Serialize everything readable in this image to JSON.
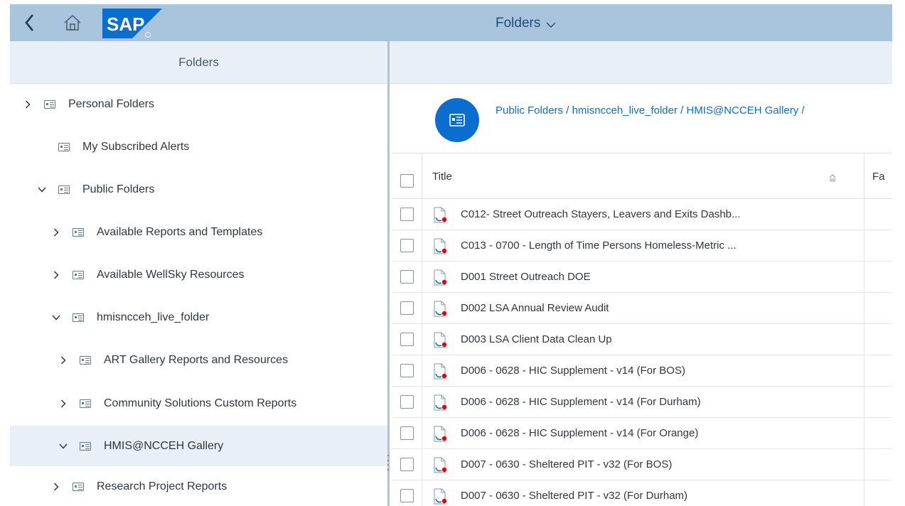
{
  "header": {
    "title": "Folders",
    "logo_text": "SAP",
    "colors": {
      "bar": "#a9c5de",
      "title": "#1f4e79",
      "logo": "#0a6ed1"
    }
  },
  "left_panel": {
    "title": "Folders",
    "items": [
      {
        "label": "Personal Folders",
        "expander": "collapsed"
      },
      {
        "label": "My Subscribed Alerts",
        "expander": "none"
      },
      {
        "label": "Public Folders",
        "expander": "expanded"
      },
      {
        "label": "Available Reports and Templates",
        "expander": "collapsed"
      },
      {
        "label": "Available WellSky Resources",
        "expander": "collapsed"
      },
      {
        "label": "hmisncceh_live_folder",
        "expander": "expanded"
      },
      {
        "label": "ART Gallery Reports and Resources",
        "expander": "collapsed"
      },
      {
        "label": "Community Solutions Custom Reports",
        "expander": "collapsed"
      },
      {
        "label": "HMIS@NCCEH Gallery",
        "expander": "expanded",
        "selected": true
      },
      {
        "label": "Research Project Reports",
        "expander": "collapsed"
      }
    ]
  },
  "breadcrumb": {
    "items": [
      "Public Folders",
      "hmisncceh_live_folder",
      "HMIS@NCCEH Gallery"
    ],
    "separator": "/"
  },
  "table": {
    "columns": {
      "title": "Title",
      "favorite": "Fa"
    },
    "rows": [
      "C012- Street Outreach Stayers, Leavers and Exits Dashb...",
      "C013 - 0700 - Length of Time Persons Homeless-Metric ...",
      "D001 Street Outreach DOE",
      "D002 LSA Annual Review Audit",
      "D003 LSA Client Data Clean Up",
      "D006 - 0628 - HIC Supplement - v14 (For BOS)",
      "D006 - 0628 - HIC Supplement - v14 (For Durham)",
      "D006 - 0628 - HIC Supplement - v14 (For Orange)",
      "D007 - 0630 - Sheltered PIT - v32 (For BOS)",
      "D007 - 0630 - Sheltered PIT - v32 (For Durham)"
    ]
  },
  "icons": {
    "back": "chevron-left-icon",
    "home": "home-icon",
    "header_dropdown": "chevron-down-icon",
    "folder": "folder-icon",
    "document": "crystal-report-icon",
    "sort": "sort-icon"
  }
}
